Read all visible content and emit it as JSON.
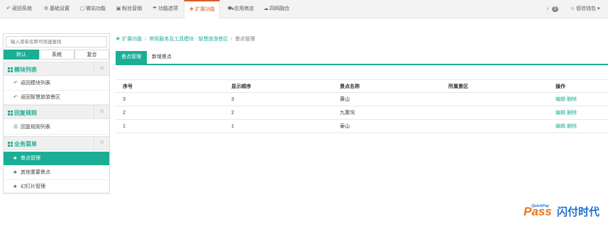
{
  "topnav": {
    "items": [
      {
        "label": "返回系统",
        "icon": "reply-icon"
      },
      {
        "label": "基础设置",
        "icon": "gear-icon"
      },
      {
        "label": "微站功能",
        "icon": "square-icon"
      },
      {
        "label": "粉丝营销",
        "icon": "briefcase-icon"
      },
      {
        "label": "功能选项",
        "icon": "umbrella-icon"
      },
      {
        "label": "扩展功能",
        "icon": "cubes-icon"
      },
      {
        "label": "应用商店",
        "icon": "cart-icon"
      },
      {
        "label": "四网融合",
        "icon": "cloud-icon"
      }
    ],
    "notifications_count": "0",
    "user_label": "佰信钱包"
  },
  "sidebar": {
    "search_placeholder": "输入菜单名称可快速查找",
    "segments": [
      "默认",
      "系统",
      "复合"
    ],
    "sections": [
      {
        "title": "模块列表",
        "items": [
          "返回模块列表",
          "返回智慧旅游景区"
        ]
      },
      {
        "title": "回复规则",
        "items": [
          "回复规则列表"
        ]
      },
      {
        "title": "业务菜单",
        "items": [
          "景点管理",
          "其他重要景点",
          "幻灯片管理"
        ]
      }
    ]
  },
  "breadcrumb": {
    "items": [
      "扩展功能",
      "常用服务及工具模块 - 智慧旅游景区",
      "景点管理"
    ]
  },
  "tabs": [
    "景点管理",
    "新增景点"
  ],
  "table": {
    "columns": [
      "序号",
      "显示顺序",
      "景点名称",
      "所属景区",
      "操作"
    ],
    "rows": [
      {
        "id": "3",
        "order": "3",
        "name": "黄山",
        "area": ""
      },
      {
        "id": "2",
        "order": "2",
        "name": "九寨沟",
        "area": ""
      },
      {
        "id": "1",
        "order": "1",
        "name": "泰山",
        "area": ""
      }
    ],
    "actions": {
      "edit": "编辑",
      "delete": "删除"
    }
  },
  "brand": {
    "pass": "Pass",
    "quick": "QuickPay",
    "cn": "闪付时代"
  },
  "colors": {
    "accent": "#1aae95",
    "active_top": "#e05a2a"
  }
}
